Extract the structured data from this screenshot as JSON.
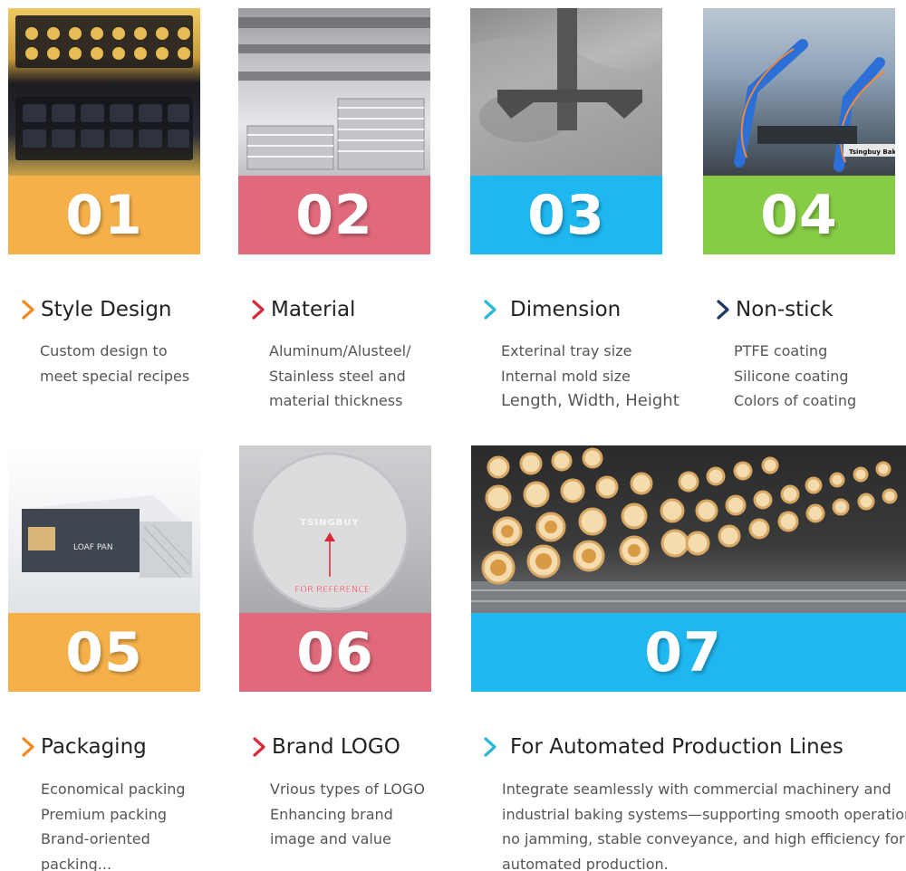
{
  "colors": {
    "orange": "#f5b04a",
    "pink": "#e06a7c",
    "cyan": "#1fb7ef",
    "green": "#86cc45",
    "chevron_orange": "#f08a1c",
    "chevron_red": "#d9283a",
    "chevron_cyan": "#29b8d6",
    "chevron_navy": "#203864"
  },
  "cards": [
    {
      "number": "01",
      "title": "Style Design",
      "lines": [
        "Custom design to",
        "meet special recipes"
      ]
    },
    {
      "number": "02",
      "title": "Material",
      "lines": [
        "Aluminum/Alusteel/",
        "Stainless steel and",
        "material thickness"
      ]
    },
    {
      "number": "03",
      "title": "Dimension",
      "lines": [
        "Exterinal tray size",
        "Internal mold size",
        "Length, Width, Height"
      ]
    },
    {
      "number": "04",
      "title": "Non-stick",
      "lines": [
        "PTFE coating",
        "Silicone coating",
        "Colors of coating"
      ],
      "photo_label": "Tsingbuy Bake"
    },
    {
      "number": "05",
      "title": "Packaging",
      "lines": [
        "Economical packing",
        "Premium packing",
        "Brand-oriented",
        "packing..."
      ],
      "photo_label": "LOAF PAN"
    },
    {
      "number": "06",
      "title": "Brand LOGO",
      "lines": [
        "Vrious types of LOGO",
        "Enhancing brand",
        "image and value"
      ],
      "photo_label": "TSINGBUY",
      "photo_note": "FOR REFERENCE"
    },
    {
      "number": "07",
      "title": "For Automated Production Lines",
      "lines": [
        "Integrate seamlessly with commercial machinery and",
        "industrial baking systems—supporting smooth operation,",
        "no jamming, stable conveyance, and high efficiency for",
        "automated production."
      ]
    }
  ]
}
